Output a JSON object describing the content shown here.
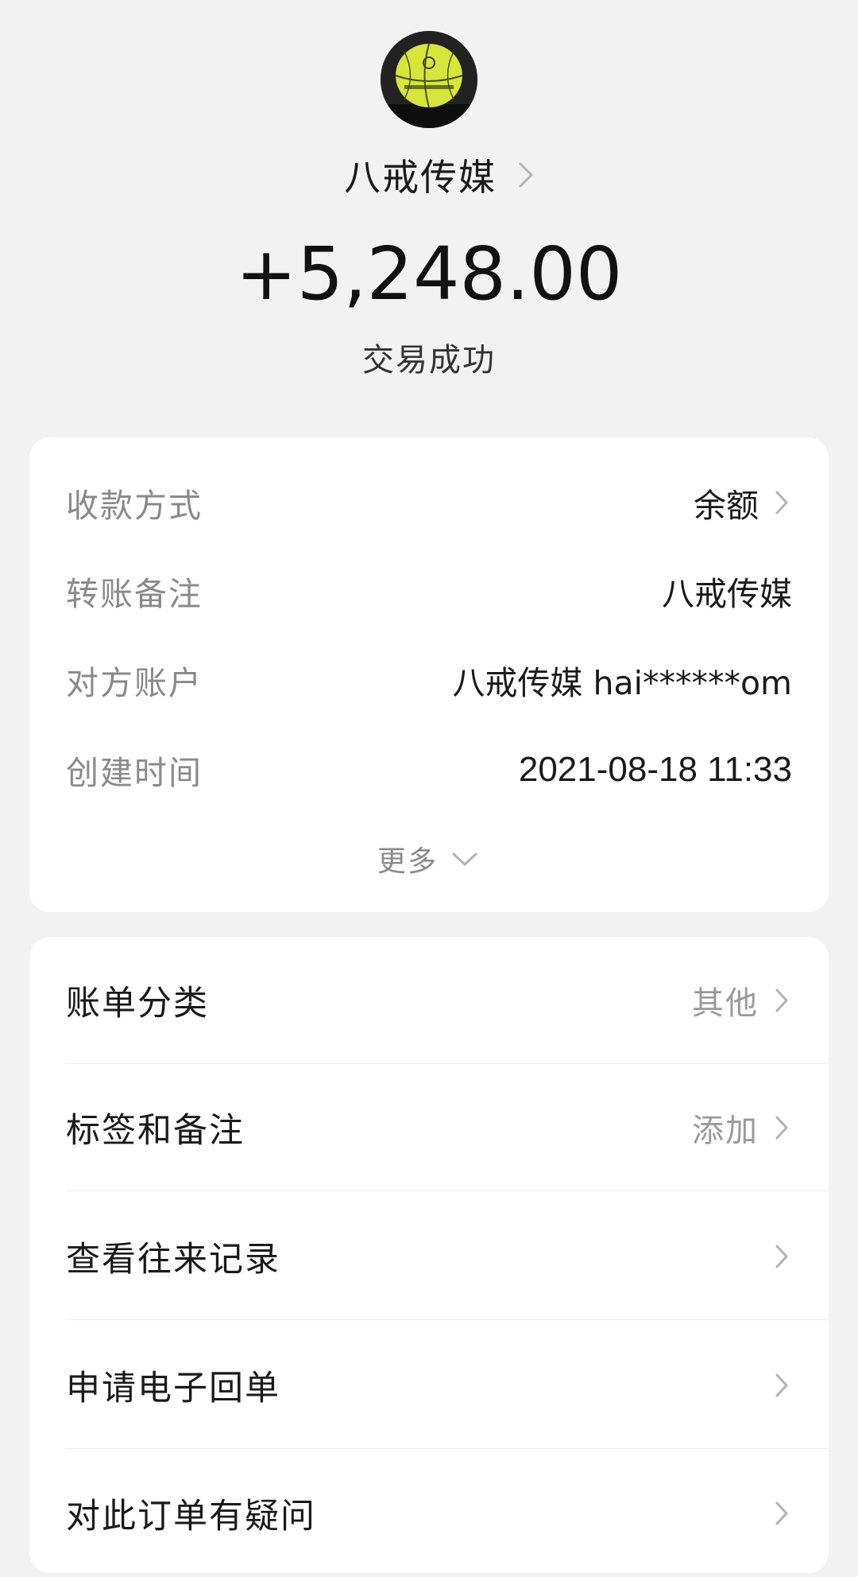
{
  "header": {
    "avatar_alt": "basketball avatar",
    "merchant_name": "八戒传媒",
    "amount": "+5,248.00",
    "status": "交易成功"
  },
  "details": {
    "rows": [
      {
        "label": "收款方式",
        "value": "余额",
        "has_chevron": true
      },
      {
        "label": "转账备注",
        "value": "八戒传媒",
        "has_chevron": false
      },
      {
        "label": "对方账户",
        "value": "八戒传媒 hai******om",
        "has_chevron": false
      },
      {
        "label": "创建时间",
        "value": "2021-08-18 11:33",
        "has_chevron": false
      }
    ],
    "more_label": "更多"
  },
  "actions": {
    "rows": [
      {
        "label": "账单分类",
        "value": "其他"
      },
      {
        "label": "标签和备注",
        "value": "添加"
      },
      {
        "label": "查看往来记录",
        "value": ""
      },
      {
        "label": "申请电子回单",
        "value": ""
      },
      {
        "label": "对此订单有疑问",
        "value": ""
      }
    ]
  },
  "icons": {
    "chevron": "chevron-right-icon",
    "expand": "chevron-down-icon"
  },
  "colors": {
    "background": "#f2f2f2",
    "card": "#ffffff",
    "label_gray": "#8a8a8a",
    "text_dark": "#1a1a1a"
  }
}
